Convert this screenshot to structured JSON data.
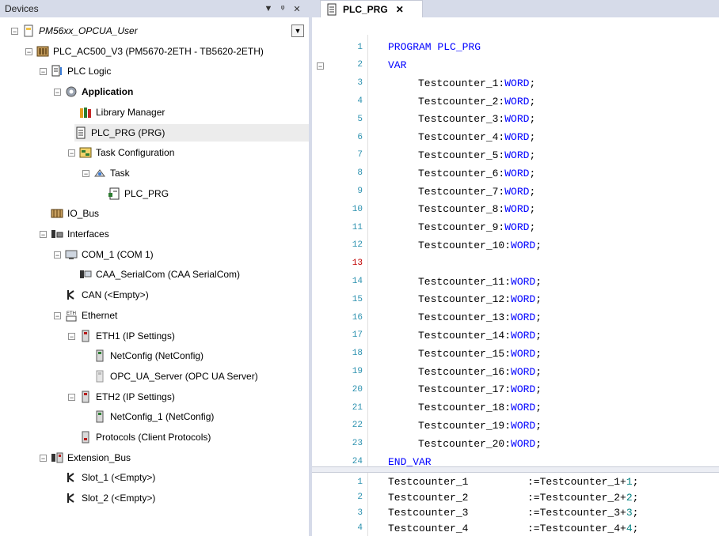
{
  "devices_panel": {
    "title": "Devices",
    "btn_dropdown": "▼",
    "btn_pin": "ᵠ",
    "btn_close": "✕",
    "tree": [
      {
        "label": "PM56xx_OPCUA_User",
        "italic": true,
        "icon": "project-icon"
      },
      {
        "label": "PLC_AC500_V3 (PM5670-2ETH - TB5620-2ETH)",
        "icon": "plc-icon"
      },
      {
        "label": "PLC Logic",
        "icon": "plc-logic-icon"
      },
      {
        "label": "Application",
        "bold": true,
        "icon": "application-gear-icon"
      },
      {
        "label": "Library Manager",
        "icon": "library-books-icon"
      },
      {
        "label": "PLC_PRG (PRG)",
        "icon": "program-document-icon",
        "selected": true
      },
      {
        "label": "Task Configuration",
        "icon": "task-configuration-icon"
      },
      {
        "label": "Task",
        "icon": "task-icon"
      },
      {
        "label": "PLC_PRG",
        "icon": "program-call-icon"
      },
      {
        "label": "IO_Bus",
        "icon": "io-bus-icon"
      },
      {
        "label": "Interfaces",
        "icon": "interfaces-icon"
      },
      {
        "label": "COM_1 (COM 1)",
        "icon": "com-port-icon"
      },
      {
        "label": "CAA_SerialCom (CAA SerialCom)",
        "icon": "serial-com-icon"
      },
      {
        "label": "CAN (<Empty>)",
        "icon": "can-connector-icon"
      },
      {
        "label": "Ethernet",
        "icon": "ethernet-icon"
      },
      {
        "label": "ETH1 (IP Settings)",
        "icon": "eth-module-icon"
      },
      {
        "label": "NetConfig (NetConfig)",
        "icon": "netconfig-icon"
      },
      {
        "label": "OPC_UA_Server (OPC UA Server)",
        "icon": "opcua-server-icon"
      },
      {
        "label": "ETH2 (IP Settings)",
        "icon": "eth-module-icon"
      },
      {
        "label": "NetConfig_1 (NetConfig)",
        "icon": "netconfig-icon"
      },
      {
        "label": "Protocols (Client Protocols)",
        "icon": "protocols-icon"
      },
      {
        "label": "Extension_Bus",
        "icon": "extension-bus-icon"
      },
      {
        "label": "Slot_1 (<Empty>)",
        "icon": "slot-connector-icon"
      },
      {
        "label": "Slot_2 (<Empty>)",
        "icon": "slot-connector-icon"
      }
    ],
    "collapse_glyph": "−",
    "dropdown_glyph": "▼"
  },
  "editor": {
    "tab_label": "PLC_PRG",
    "tab_close": "✕",
    "fold_glyph": "−",
    "decl_lines": [
      {
        "n": "1",
        "kw": "PROGRAM",
        "rest": " PLC_PRG",
        "indent": 0
      },
      {
        "n": "2",
        "kw": "VAR",
        "rest": "",
        "indent": 0
      },
      {
        "n": "3",
        "name": "Testcounter_1:",
        "type": "WORD",
        "semi": ";",
        "indent": 1
      },
      {
        "n": "4",
        "name": "Testcounter_2:",
        "type": "WORD",
        "semi": ";",
        "indent": 1
      },
      {
        "n": "5",
        "name": "Testcounter_3:",
        "type": "WORD",
        "semi": ";",
        "indent": 1
      },
      {
        "n": "6",
        "name": "Testcounter_4:",
        "type": "WORD",
        "semi": ";",
        "indent": 1
      },
      {
        "n": "7",
        "name": "Testcounter_5:",
        "type": "WORD",
        "semi": ";",
        "indent": 1
      },
      {
        "n": "8",
        "name": "Testcounter_6:",
        "type": "WORD",
        "semi": ";",
        "indent": 1
      },
      {
        "n": "9",
        "name": "Testcounter_7:",
        "type": "WORD",
        "semi": ";",
        "indent": 1
      },
      {
        "n": "10",
        "name": "Testcounter_8:",
        "type": "WORD",
        "semi": ";",
        "indent": 1
      },
      {
        "n": "11",
        "name": "Testcounter_9:",
        "type": "WORD",
        "semi": ";",
        "indent": 1
      },
      {
        "n": "12",
        "name": "Testcounter_10:",
        "type": "WORD",
        "semi": ";",
        "indent": 1
      },
      {
        "n": "13",
        "empty": true,
        "current": true
      },
      {
        "n": "14",
        "name": "Testcounter_11:",
        "type": "WORD",
        "semi": ";",
        "indent": 1
      },
      {
        "n": "15",
        "name": "Testcounter_12:",
        "type": "WORD",
        "semi": ";",
        "indent": 1
      },
      {
        "n": "16",
        "name": "Testcounter_13:",
        "type": "WORD",
        "semi": ";",
        "indent": 1
      },
      {
        "n": "17",
        "name": "Testcounter_14:",
        "type": "WORD",
        "semi": ";",
        "indent": 1
      },
      {
        "n": "18",
        "name": "Testcounter_15:",
        "type": "WORD",
        "semi": ";",
        "indent": 1
      },
      {
        "n": "19",
        "name": "Testcounter_16:",
        "type": "WORD",
        "semi": ";",
        "indent": 1
      },
      {
        "n": "20",
        "name": "Testcounter_17:",
        "type": "WORD",
        "semi": ";",
        "indent": 1
      },
      {
        "n": "21",
        "name": "Testcounter_18:",
        "type": "WORD",
        "semi": ";",
        "indent": 1
      },
      {
        "n": "22",
        "name": "Testcounter_19:",
        "type": "WORD",
        "semi": ";",
        "indent": 1
      },
      {
        "n": "23",
        "name": "Testcounter_20:",
        "type": "WORD",
        "semi": ";",
        "indent": 1
      },
      {
        "n": "24",
        "kw": "END_VAR",
        "rest": "",
        "indent": 0
      }
    ],
    "body_lines": [
      {
        "n": "1",
        "lhs": "Testcounter_1",
        "rhs": ":=Testcounter_1+",
        "num": "1",
        "end": ";"
      },
      {
        "n": "2",
        "lhs": "Testcounter_2",
        "rhs": ":=Testcounter_2+",
        "num": "2",
        "end": ";"
      },
      {
        "n": "3",
        "lhs": "Testcounter_3",
        "rhs": ":=Testcounter_3+",
        "num": "3",
        "end": ";"
      },
      {
        "n": "4",
        "lhs": "Testcounter_4",
        "rhs": ":=Testcounter_4+",
        "num": "4",
        "end": ";"
      }
    ],
    "colors": {
      "keyword": "#0000ff",
      "line_number": "#2b91af",
      "current_line_number": "#c00000",
      "number": "#008080"
    }
  }
}
